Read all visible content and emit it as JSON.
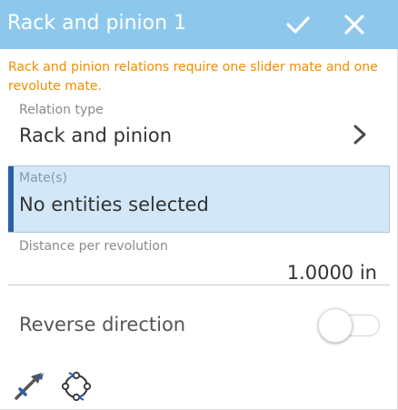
{
  "header": {
    "title": "Rack and pinion 1",
    "accept_icon": "checkmark-icon",
    "close_icon": "close-icon",
    "color": "#8dc8ec"
  },
  "warning": {
    "text": "Rack and pinion relations require one slider mate and one revolute mate.",
    "color": "#f08c00"
  },
  "relation_type": {
    "label": "Relation type",
    "value": "Rack and pinion",
    "icon": "chevron-right-icon"
  },
  "mates": {
    "label": "Mate(s)",
    "value": "No entities selected",
    "highlight_color": "#d2e8f8",
    "accent_color": "#2a5fa8"
  },
  "distance": {
    "label": "Distance per revolution",
    "value": "1.0000 in"
  },
  "reverse_direction": {
    "label": "Reverse direction",
    "enabled": false
  },
  "footer_tools": [
    {
      "icon": "mate-connector-icon"
    },
    {
      "icon": "circular-mate-icon"
    }
  ]
}
